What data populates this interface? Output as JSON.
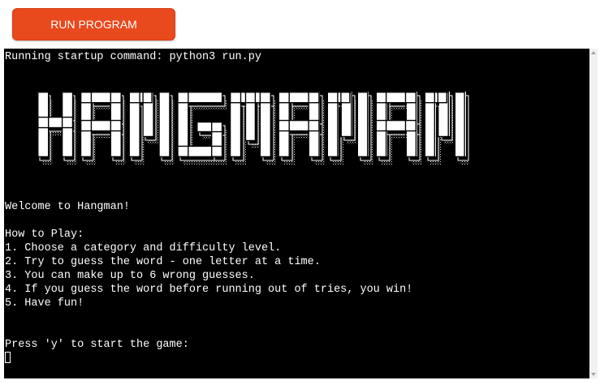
{
  "toolbar": {
    "run_label": "RUN PROGRAM"
  },
  "terminal": {
    "startup_line": "Running startup command: python3 run.py",
    "banner_text": "HANGMAN",
    "lines": [
      "Welcome to Hangman!",
      "",
      "How to Play:",
      "1. Choose a category and difficulty level.",
      "2. Try to guess the word - one letter at a time.",
      "3. You can make up to 6 wrong guesses.",
      "4. If you guess the word before running out of tries, you win!",
      "5. Have fun!",
      "",
      "",
      "Press 'y' to start the game:"
    ]
  },
  "colors": {
    "accent": "#e8491d",
    "terminal_bg": "#000000",
    "terminal_fg": "#ffffff"
  }
}
